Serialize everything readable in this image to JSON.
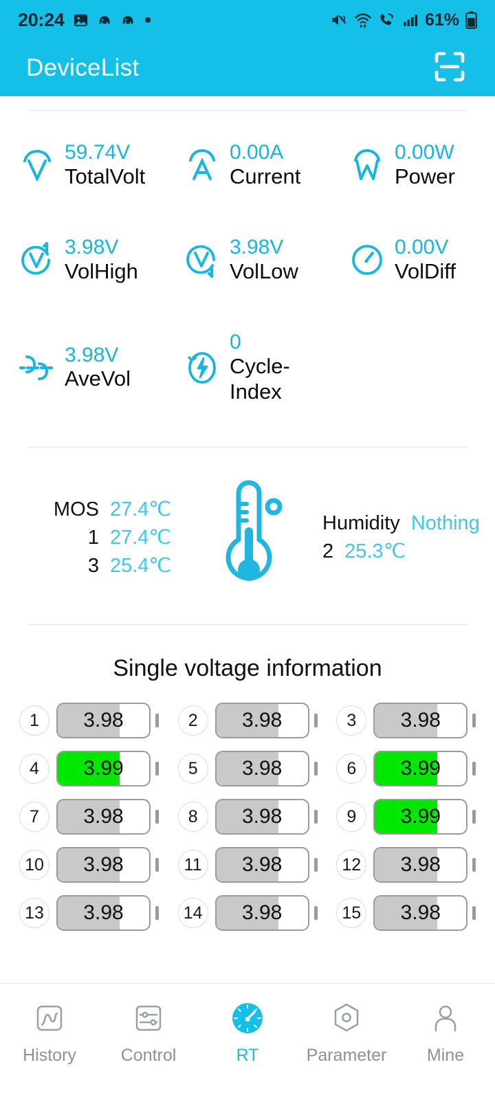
{
  "statusbar": {
    "time": "20:24",
    "battery": "61%",
    "icons": [
      "image-icon",
      "app-icon",
      "app-icon",
      "dot-icon",
      "mute-icon",
      "wifi-icon",
      "call-icon",
      "signal-icon",
      "battery-icon"
    ]
  },
  "appbar": {
    "title": "DeviceList",
    "scan_icon": "scan-icon"
  },
  "metrics": [
    {
      "icon": "volt-meter-icon",
      "value": "59.74V",
      "label": "TotalVolt"
    },
    {
      "icon": "ampere-meter-icon",
      "value": "0.00A",
      "label": "Current"
    },
    {
      "icon": "watt-meter-icon",
      "value": "0.00W",
      "label": "Power"
    },
    {
      "icon": "volt-high-icon",
      "value": "3.98V",
      "label": "VolHigh"
    },
    {
      "icon": "volt-low-icon",
      "value": "3.98V",
      "label": "VolLow"
    },
    {
      "icon": "gauge-icon",
      "value": "0.00V",
      "label": "VolDiff"
    },
    {
      "icon": "average-volt-icon",
      "value": "3.98V",
      "label": "AveVol"
    },
    {
      "icon": "cycle-bolt-icon",
      "value": "0",
      "label": "Cycle-Index"
    }
  ],
  "temperature": {
    "thermometer_icon": "thermometer-icon",
    "left": [
      {
        "key": "MOS",
        "value": "27.4℃"
      },
      {
        "key": "1",
        "value": "27.4℃"
      },
      {
        "key": "3",
        "value": "25.4℃"
      }
    ],
    "right": [
      {
        "key": "Humidity",
        "value": "Nothing"
      },
      {
        "key": "2",
        "value": "25.3℃"
      }
    ]
  },
  "single_voltage": {
    "title": "Single voltage information",
    "cells": [
      {
        "index": "1",
        "value": "3.98",
        "fill": 68,
        "high": false
      },
      {
        "index": "2",
        "value": "3.98",
        "fill": 68,
        "high": false
      },
      {
        "index": "3",
        "value": "3.98",
        "fill": 68,
        "high": false
      },
      {
        "index": "4",
        "value": "3.99",
        "fill": 68,
        "high": true
      },
      {
        "index": "5",
        "value": "3.98",
        "fill": 68,
        "high": false
      },
      {
        "index": "6",
        "value": "3.99",
        "fill": 68,
        "high": true
      },
      {
        "index": "7",
        "value": "3.98",
        "fill": 68,
        "high": false
      },
      {
        "index": "8",
        "value": "3.98",
        "fill": 68,
        "high": false
      },
      {
        "index": "9",
        "value": "3.99",
        "fill": 68,
        "high": true
      },
      {
        "index": "10",
        "value": "3.98",
        "fill": 68,
        "high": false
      },
      {
        "index": "11",
        "value": "3.98",
        "fill": 68,
        "high": false
      },
      {
        "index": "12",
        "value": "3.98",
        "fill": 68,
        "high": false
      },
      {
        "index": "13",
        "value": "3.98",
        "fill": 68,
        "high": false
      },
      {
        "index": "14",
        "value": "3.98",
        "fill": 68,
        "high": false
      },
      {
        "index": "15",
        "value": "3.98",
        "fill": 68,
        "high": false
      }
    ]
  },
  "tabbar": {
    "items": [
      {
        "label": "History",
        "icon": "chart-line-icon",
        "active": false
      },
      {
        "label": "Control",
        "icon": "sliders-icon",
        "active": false
      },
      {
        "label": "RT",
        "icon": "speedometer-icon",
        "active": true
      },
      {
        "label": "Parameter",
        "icon": "hexagon-gear-icon",
        "active": false
      },
      {
        "label": "Mine",
        "icon": "person-icon",
        "active": false
      }
    ]
  },
  "colors": {
    "accent": "#14bfe8",
    "value_text": "#17b6e0",
    "high_cell": "#00e800",
    "normal_cell": "#c9c9c9",
    "inactive_tab": "#8b9297"
  }
}
